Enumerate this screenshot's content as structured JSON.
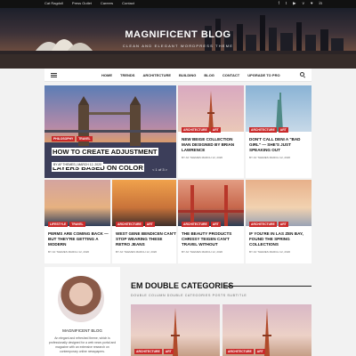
{
  "topbar": {
    "links": [
      "Cat Ragdoll",
      "Press Outlet",
      "Careers",
      "Contact"
    ],
    "social": [
      "f",
      "t",
      "▶",
      "v",
      "♥",
      "in"
    ]
  },
  "hero": {
    "title": "MAGNIFICENT BLOG",
    "tagline": "CLEAN AND ELEGANT WORDPRESS THEME"
  },
  "nav": {
    "items": [
      "HOME",
      "TRENDS",
      "ARCHITECTURE",
      "BUILDING",
      "BLOG",
      "CONTACT",
      "UPGRADE TO PRO"
    ]
  },
  "featured": {
    "categories": [
      "PHILOSOPHY",
      "TRAVEL"
    ],
    "title": "HOW TO CREATE ADJUSTMENT LAYERS BASED ON COLOR",
    "meta": "BY AF THEMES | MARCH 12, 2020",
    "pager": "< 1 of 3 >"
  },
  "posts": [
    {
      "categories": [
        "ARCHITECTURE",
        "ART"
      ],
      "title": "NEW BEIGE COLLECTION MAN DESIGNED BY BRIAN LAWRENCE",
      "meta": "BY AF THEMES  MARCH 12, 2020"
    },
    {
      "categories": [
        "ARCHITECTURE",
        "ART"
      ],
      "title": "DON'T CALL DENI A \"BAD GIRL\" — SHE'S JUST SPEAKING OUT",
      "meta": "BY AF THEMES  MARCH 12, 2020"
    },
    {
      "categories": [
        "LIFESTYLE",
        "TRAVEL"
      ],
      "title": "PERMS ARE COMING BACK — BUT THEY'RE GETTING A MODERN",
      "meta": "BY AF THEMES  MARCH 12, 2020"
    },
    {
      "categories": [
        "ARCHITECTURE",
        "ART"
      ],
      "title": "WEST GENE BENDICEN CAN'T STOP WEARING THESE RETRO JEANS",
      "meta": "BY AF THEMES  MARCH 12, 2020"
    },
    {
      "categories": [
        "ARCHITECTURE",
        "ART"
      ],
      "title": "THE BEAUTY PRODUCTS CHRISSY TEIGEN CAN'T TRAVEL WITHOUT",
      "meta": "BY AF THEMES  MARCH 12, 2020"
    },
    {
      "categories": [
        "ARCHITECTURE",
        "ART"
      ],
      "title": "IF YOU'RE IN LAS ZEN BAY, FOUND THE SPRING COLLECTIONS",
      "meta": "BY AF THEMES  MARCH 12, 2020"
    }
  ],
  "author": {
    "name": "MAGNIFICENT BLOG",
    "bio": "An elegant and refreshed theme, which is professionally designed for a web news portal and magazine with an extensive research on contemporary online newspapers."
  },
  "double": {
    "title": "EM DOUBLE CATEGORIES",
    "subtitle": "DOUBLE COLUMN DOUBLE CATEGORIES POSTS SUBTITLE",
    "cards": [
      {
        "categories": [
          "ARCHITECTURE",
          "ART"
        ]
      },
      {
        "categories": [
          "ARCHITECTURE",
          "ART"
        ]
      }
    ]
  }
}
